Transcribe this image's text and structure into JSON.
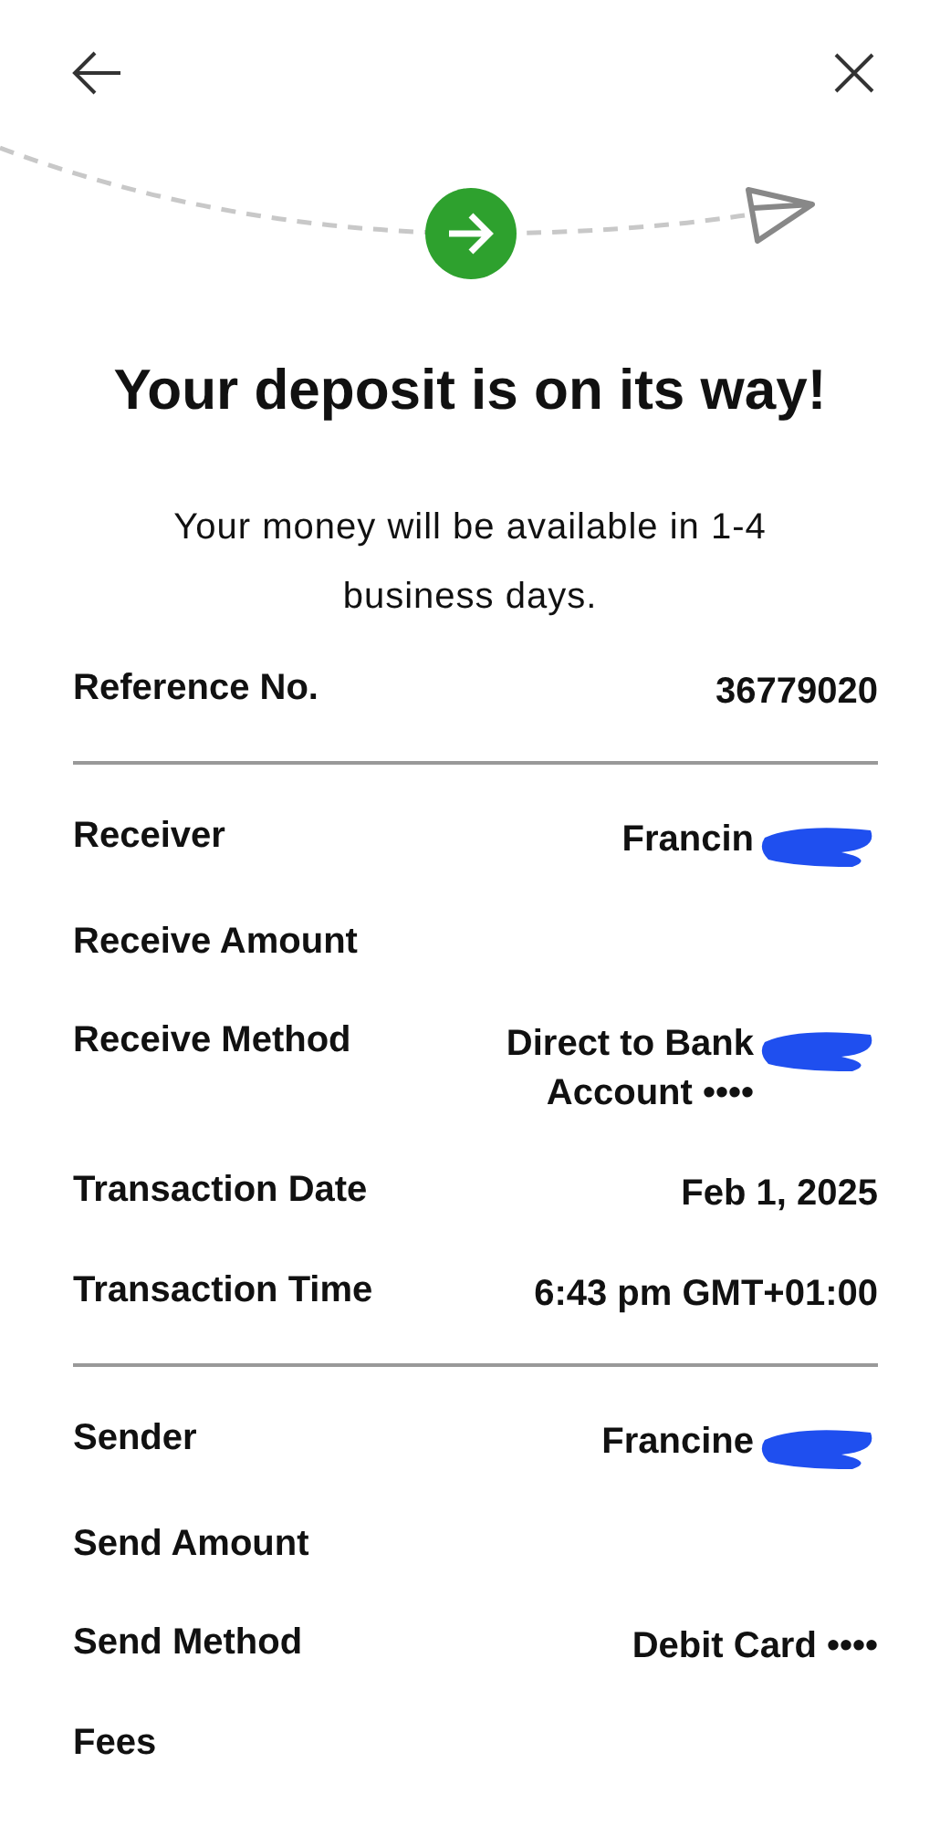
{
  "title": "Your deposit is on its way!",
  "subtitle": "Your money will be available in 1-4 business days.",
  "sections": [
    {
      "rows": [
        {
          "label": "Reference No.",
          "value": "36779020",
          "redacted": false
        }
      ]
    },
    {
      "rows": [
        {
          "label": "Receiver",
          "value": "Francin",
          "redacted": true
        },
        {
          "label": "Receive Amount",
          "redacted": false
        },
        {
          "label": "Receive Method",
          "value": "Direct to Bank Account ••••",
          "redacted": true
        },
        {
          "label": "Transaction Date",
          "value": "Feb 1, 2025",
          "redacted": false
        },
        {
          "label": "Transaction Time",
          "value": "6:43 pm GMT+01:00",
          "redacted": false
        }
      ]
    },
    {
      "rows": [
        {
          "label": "Sender",
          "value": "Francine",
          "redacted": true
        },
        {
          "label": "Send Amount",
          "redacted": false
        },
        {
          "label": "Send Method",
          "value": "Debit Card ••••",
          "redacted": false
        },
        {
          "label": "Fees",
          "redacted": false
        }
      ]
    }
  ]
}
